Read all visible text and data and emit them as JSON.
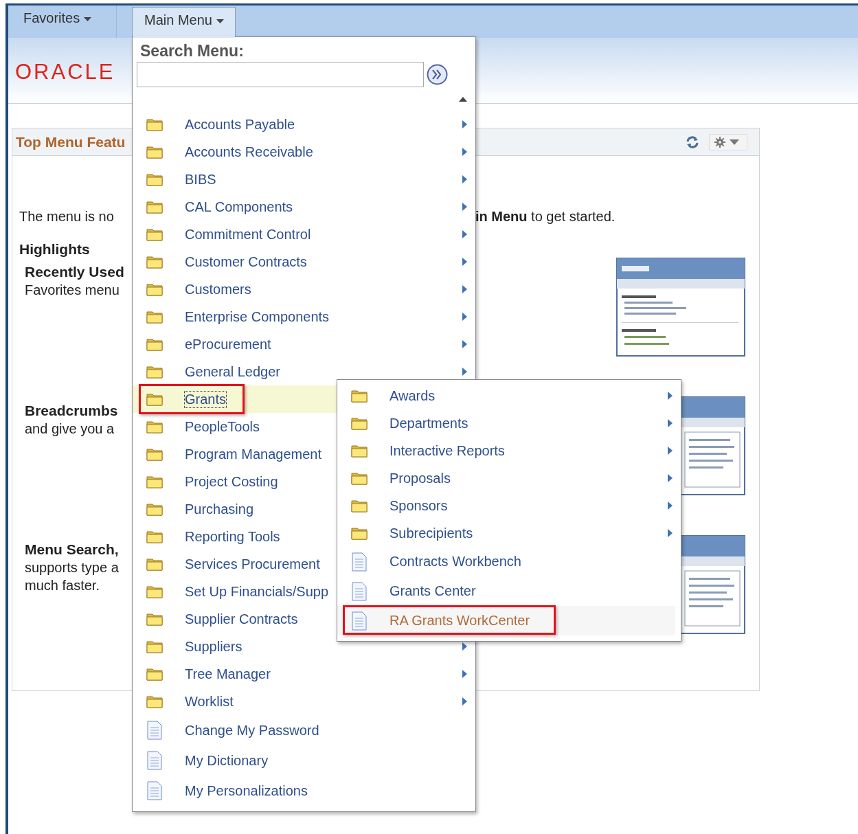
{
  "nav": {
    "tabs": [
      {
        "label": "Favorites",
        "selected": false
      },
      {
        "label": "Main Menu",
        "selected": true
      }
    ]
  },
  "logo": {
    "text": "ORACLE"
  },
  "panel": {
    "title": "Top Menu Featu",
    "intro_left": "The menu is no",
    "intro_right": "**in Menu** to get started.",
    "heading": "Highlights",
    "sections": [
      {
        "title": "Recently Used",
        "lines": [
          "Favorites menu"
        ]
      },
      {
        "title": "Breadcrumbs",
        "lines": [
          "and give you a"
        ]
      },
      {
        "title": "Menu Search,",
        "lines": [
          "supports type a",
          "much faster."
        ]
      }
    ]
  },
  "main_menu": {
    "search_label": "Search Menu:",
    "items": [
      {
        "label": "Accounts Payable",
        "kind": "folder",
        "submenu_arrow": true,
        "selected": false,
        "marked": false
      },
      {
        "label": "Accounts Receivable",
        "kind": "folder",
        "submenu_arrow": true,
        "selected": false,
        "marked": false
      },
      {
        "label": "BIBS",
        "kind": "folder",
        "submenu_arrow": true,
        "selected": false,
        "marked": false
      },
      {
        "label": "CAL Components",
        "kind": "folder",
        "submenu_arrow": true,
        "selected": false,
        "marked": false
      },
      {
        "label": "Commitment Control",
        "kind": "folder",
        "submenu_arrow": true,
        "selected": false,
        "marked": false
      },
      {
        "label": "Customer Contracts",
        "kind": "folder",
        "submenu_arrow": true,
        "selected": false,
        "marked": false
      },
      {
        "label": "Customers",
        "kind": "folder",
        "submenu_arrow": true,
        "selected": false,
        "marked": false
      },
      {
        "label": "Enterprise Components",
        "kind": "folder",
        "submenu_arrow": true,
        "selected": false,
        "marked": false
      },
      {
        "label": "eProcurement",
        "kind": "folder",
        "submenu_arrow": true,
        "selected": false,
        "marked": false
      },
      {
        "label": "General Ledger",
        "kind": "folder",
        "submenu_arrow": true,
        "selected": false,
        "marked": false
      },
      {
        "label": "Grants",
        "kind": "folder",
        "submenu_arrow": false,
        "selected": true,
        "marked": true
      },
      {
        "label": "PeopleTools",
        "kind": "folder",
        "submenu_arrow": false,
        "selected": false,
        "marked": false
      },
      {
        "label": "Program Management",
        "kind": "folder",
        "submenu_arrow": false,
        "selected": false,
        "marked": false
      },
      {
        "label": "Project Costing",
        "kind": "folder",
        "submenu_arrow": false,
        "selected": false,
        "marked": false
      },
      {
        "label": "Purchasing",
        "kind": "folder",
        "submenu_arrow": false,
        "selected": false,
        "marked": false
      },
      {
        "label": "Reporting Tools",
        "kind": "folder",
        "submenu_arrow": false,
        "selected": false,
        "marked": false
      },
      {
        "label": "Services Procurement",
        "kind": "folder",
        "submenu_arrow": false,
        "selected": false,
        "marked": false
      },
      {
        "label": "Set Up Financials/Supp",
        "kind": "folder",
        "submenu_arrow": false,
        "selected": false,
        "marked": false
      },
      {
        "label": "Supplier Contracts",
        "kind": "folder",
        "submenu_arrow": false,
        "selected": false,
        "marked": false
      },
      {
        "label": "Suppliers",
        "kind": "folder",
        "submenu_arrow": true,
        "selected": false,
        "marked": false
      },
      {
        "label": "Tree Manager",
        "kind": "folder",
        "submenu_arrow": true,
        "selected": false,
        "marked": false
      },
      {
        "label": "Worklist",
        "kind": "folder",
        "submenu_arrow": true,
        "selected": false,
        "marked": false
      },
      {
        "label": "Change My Password",
        "kind": "page",
        "submenu_arrow": false,
        "selected": false,
        "marked": false
      },
      {
        "label": "My Dictionary",
        "kind": "page",
        "submenu_arrow": false,
        "selected": false,
        "marked": false
      },
      {
        "label": "My Personalizations",
        "kind": "page",
        "submenu_arrow": false,
        "selected": false,
        "marked": false
      }
    ]
  },
  "submenu": {
    "items": [
      {
        "label": "Awards",
        "kind": "folder",
        "submenu_arrow": true,
        "selected": false,
        "marked": false
      },
      {
        "label": "Departments",
        "kind": "folder",
        "submenu_arrow": true,
        "selected": false,
        "marked": false
      },
      {
        "label": "Interactive Reports",
        "kind": "folder",
        "submenu_arrow": true,
        "selected": false,
        "marked": false
      },
      {
        "label": "Proposals",
        "kind": "folder",
        "submenu_arrow": true,
        "selected": false,
        "marked": false
      },
      {
        "label": "Sponsors",
        "kind": "folder",
        "submenu_arrow": true,
        "selected": false,
        "marked": false
      },
      {
        "label": "Subrecipients",
        "kind": "folder",
        "submenu_arrow": true,
        "selected": false,
        "marked": false
      },
      {
        "label": "Contracts Workbench",
        "kind": "page",
        "submenu_arrow": false,
        "selected": false,
        "marked": false
      },
      {
        "label": "Grants Center",
        "kind": "page",
        "submenu_arrow": false,
        "selected": false,
        "marked": false
      },
      {
        "label": "RA Grants WorkCenter",
        "kind": "page",
        "submenu_arrow": false,
        "selected": true,
        "marked": true
      }
    ]
  }
}
